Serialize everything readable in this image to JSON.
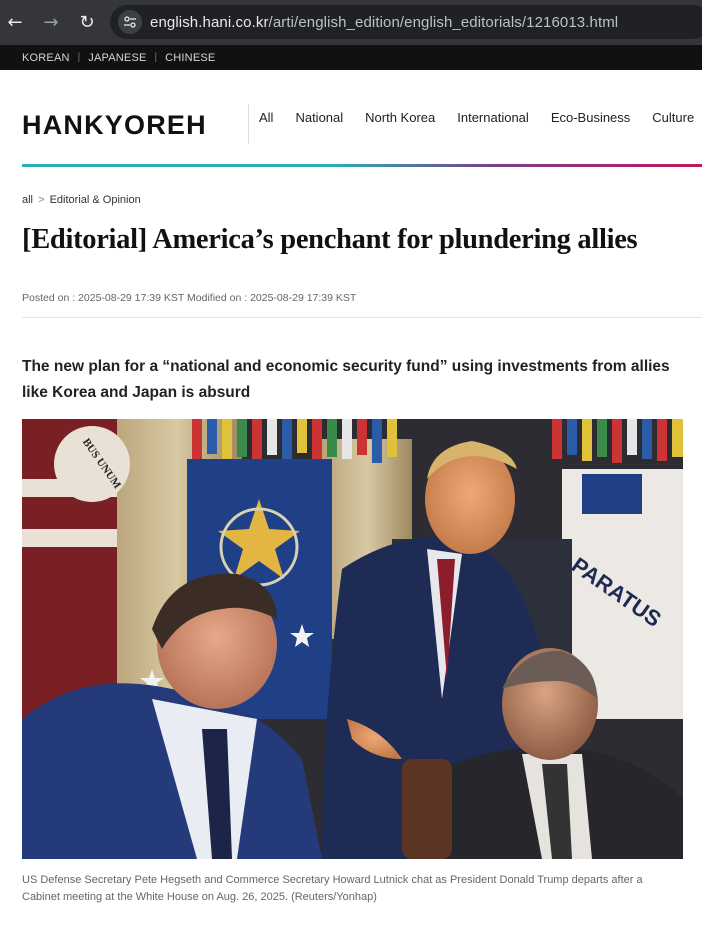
{
  "browser": {
    "url_host": "english.hani.co.kr",
    "url_path": "/arti/english_edition/english_editorials/1216013.html"
  },
  "lang_bar": {
    "items": [
      "KOREAN",
      "JAPANESE",
      "CHINESE"
    ],
    "separator": "|"
  },
  "header": {
    "logo": "HANKYOREH",
    "nav": [
      "All",
      "National",
      "North Korea",
      "International",
      "Eco-Business",
      "Culture"
    ]
  },
  "article": {
    "breadcrumb": [
      "all",
      "Editorial & Opinion"
    ],
    "breadcrumb_sep": ">",
    "title": "[Editorial] America’s penchant for plundering allies",
    "posted_label": "Posted on :",
    "posted": "2025-08-29 17:39 KST",
    "modified_label": "Modified on :",
    "modified": "2025-08-29 17:39 KST",
    "subhead": "The new plan for a “national and economic security fund” using investments from allies like Korea and Japan is absurd",
    "caption": "US Defense Secretary Pete Hegseth and Commerce Secretary Howard Lutnick chat as President Donald Trump departs after a Cabinet meeting at the White House on Aug. 26, 2025. (Reuters/Yonhap)"
  },
  "photo_flag_text": {
    "left_motto": "BUS UNUM",
    "right_motto": "PARATUS"
  },
  "colors": {
    "accent_line_start": "#2ab0b8",
    "accent_line_end": "#c2185b",
    "browser_bg": "#35363a",
    "lang_bar_bg": "#111111"
  }
}
